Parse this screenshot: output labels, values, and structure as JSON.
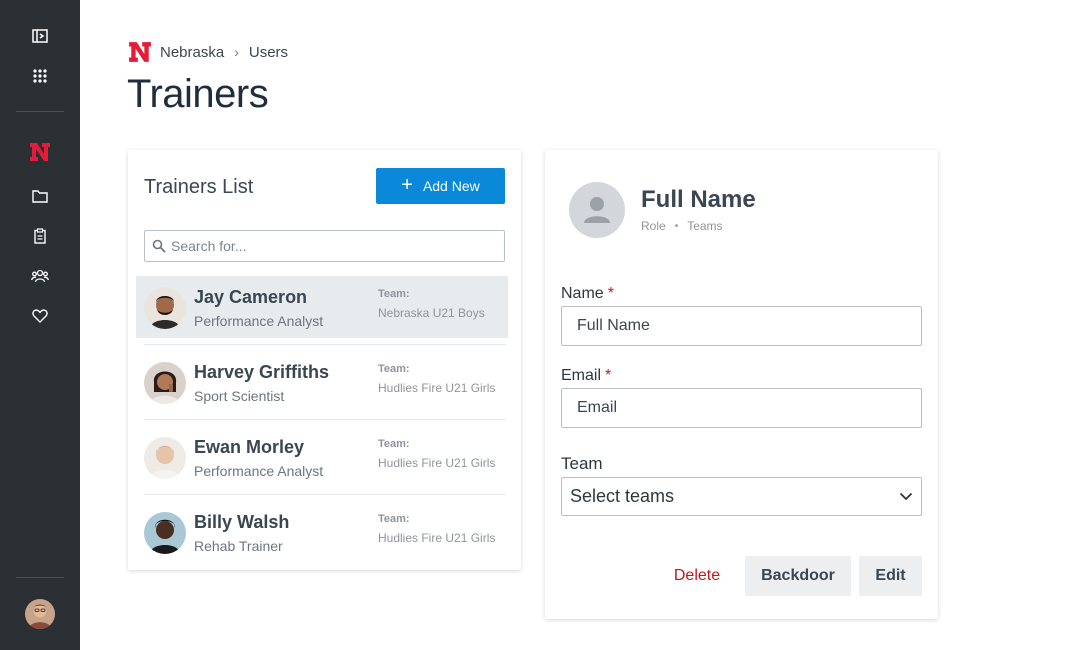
{
  "sidebar": {
    "icons": [
      "collapse-sidebar-icon",
      "apps-grid-icon",
      "nebraska-logo-icon",
      "folder-icon",
      "clipboard-icon",
      "users-icon",
      "heart-icon"
    ]
  },
  "breadcrumb": {
    "org": "Nebraska",
    "separator": "›",
    "page": "Users"
  },
  "page": {
    "title": "Trainers"
  },
  "list": {
    "title": "Trainers List",
    "add_label": "Add New",
    "search_placeholder": "Search for...",
    "team_label": "Team:",
    "items": [
      {
        "name": "Jay Cameron",
        "role": "Performance Analyst",
        "team": "Nebraska U21 Boys"
      },
      {
        "name": "Harvey Griffiths",
        "role": "Sport Scientist",
        "team": "Hudlies Fire U21 Girls"
      },
      {
        "name": "Ewan Morley",
        "role": "Performance Analyst",
        "team": "Hudlies Fire U21 Girls"
      },
      {
        "name": "Billy Walsh",
        "role": "Rehab Trainer",
        "team": "Hudlies Fire U21 Girls"
      }
    ]
  },
  "detail": {
    "name": "Full Name",
    "role": "Role",
    "dot": "•",
    "teams": "Teams",
    "fields": {
      "name_label": "Name",
      "name_placeholder": "Full Name",
      "email_label": "Email",
      "email_placeholder": "Email",
      "required_mark": "*",
      "team_label": "Team",
      "team_value": "Select teams"
    },
    "buttons": {
      "delete": "Delete",
      "backdoor": "Backdoor",
      "edit": "Edit"
    }
  },
  "colors": {
    "accent": "#0a88d9",
    "brand": "#e41c38",
    "danger": "#c4161c",
    "sidebar": "#2b3035"
  }
}
